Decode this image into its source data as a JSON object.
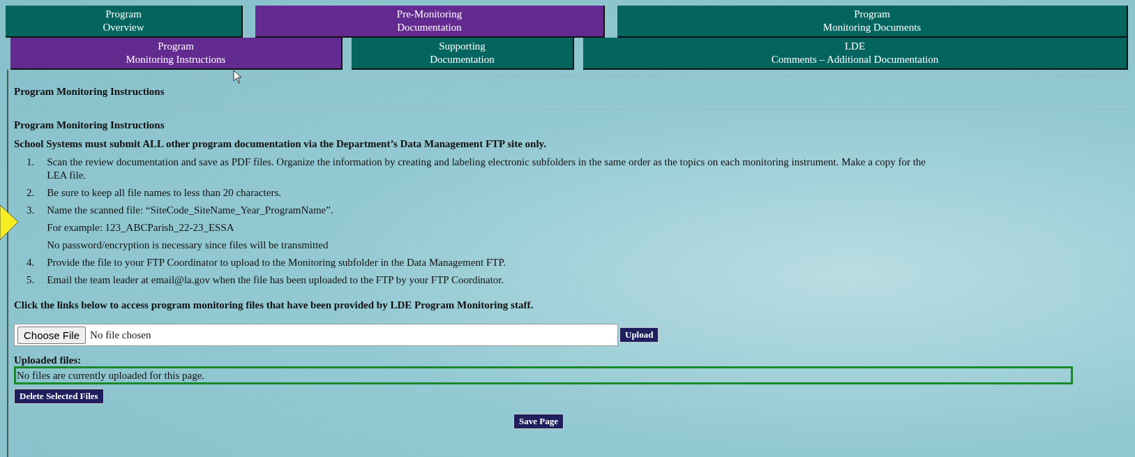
{
  "tab_rows": [
    {
      "tabs": [
        {
          "lines": [
            "Program",
            "Overview"
          ],
          "selected": false
        },
        {
          "lines": [
            "Pre-Monitoring",
            "Documentation"
          ],
          "selected": true
        },
        {
          "lines": [
            "Program",
            "Monitoring Documents"
          ],
          "selected": false
        }
      ]
    },
    {
      "tabs": [
        {
          "lines": [
            "Program",
            "Monitoring Instructions"
          ],
          "selected": true
        },
        {
          "lines": [
            "Supporting",
            "Documentation"
          ],
          "selected": false
        },
        {
          "lines": [
            "LDE",
            "Comments – Additional Documentation"
          ],
          "selected": false
        }
      ]
    }
  ],
  "page_heading": "Program Monitoring Instructions",
  "section_heading": "Program Monitoring Instructions",
  "notice": "School Systems must submit ALL other program documentation via the Department’s Data Management FTP site only.",
  "steps": [
    {
      "number": "1.",
      "lines": [
        "Scan the review documentation and save as PDF files. Organize the information by creating and labeling electronic subfolders in the same order as the topics on each monitoring instrument. Make a copy for the LEA file."
      ]
    },
    {
      "number": "2.",
      "lines": [
        "Be sure to keep all file names to less than 20 characters."
      ]
    },
    {
      "number": "3.",
      "lines": [
        "Name the scanned file: “SiteCode_SiteName_Year_ProgramName”.",
        "For example:  123_ABCParish_22-23_ESSA",
        "No password/encryption is necessary since files will be transmitted"
      ]
    },
    {
      "number": "4.",
      "lines": [
        "Provide the file to your FTP Coordinator to upload to the Monitoring subfolder in the Data Management FTP."
      ]
    },
    {
      "number": "5.",
      "lines": [
        "Email the team leader at email@la.gov when the file has been uploaded to the FTP by your FTP Coordinator."
      ]
    }
  ],
  "links_intro": "Click the links below to access program monitoring files that have been provided by LDE Program Monitoring staff.",
  "file_input": {
    "button": "Choose File",
    "status": "No file chosen"
  },
  "upload_button": "Upload",
  "uploaded_label": "Uploaded files:",
  "uploaded_message": "No files are currently uploaded for this page.",
  "delete_button": "Delete Selected Files",
  "save_button": "Save Page"
}
